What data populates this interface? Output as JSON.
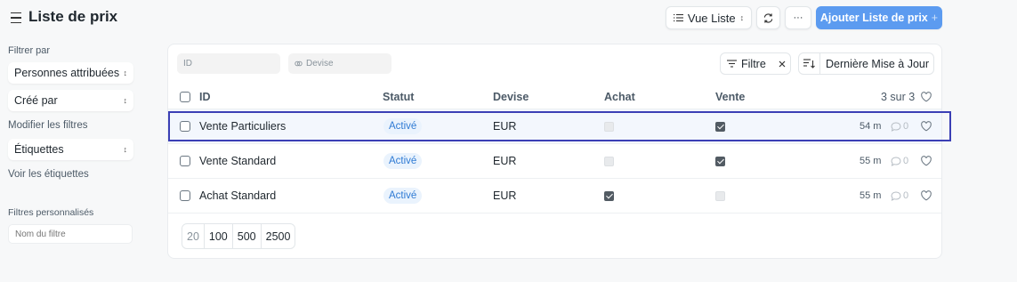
{
  "header": {
    "title": "Liste de prix",
    "view_label": "Vue Liste",
    "more_label": "···",
    "add_label": "Ajouter Liste de prix",
    "add_plus": "+"
  },
  "sidebar": {
    "filter_by": "Filtrer par",
    "assigned": "Personnes attribuées",
    "created_by": "Créé par",
    "edit_filters": "Modifier les filtres",
    "tags": "Étiquettes",
    "show_tags": "Voir les étiquettes",
    "custom_filters": "Filtres personnalisés",
    "filter_name_placeholder": "Nom du filtre"
  },
  "toolbar": {
    "id_placeholder": "ID",
    "currency_placeholder": "Devise",
    "filter_label": "Filtre",
    "sort_label": "Dernière Mise à Jour"
  },
  "table": {
    "columns": {
      "id": "ID",
      "status": "Statut",
      "currency": "Devise",
      "buying": "Achat",
      "selling": "Vente",
      "count": "3 sur 3"
    },
    "rows": [
      {
        "name": "Vente Particuliers",
        "status": "Activé",
        "currency": "EUR",
        "buying": false,
        "selling": true,
        "time": "54 m",
        "comments": "0"
      },
      {
        "name": "Vente Standard",
        "status": "Activé",
        "currency": "EUR",
        "buying": false,
        "selling": true,
        "time": "55 m",
        "comments": "0"
      },
      {
        "name": "Achat Standard",
        "status": "Activé",
        "currency": "EUR",
        "buying": true,
        "selling": false,
        "time": "55 m",
        "comments": "0"
      }
    ]
  },
  "paging": [
    "20",
    "100",
    "500",
    "2500"
  ],
  "colors": {
    "accent": "#5c9bf0",
    "badge_text": "#2f7bd4",
    "badge_bg": "#eaf3fd",
    "highlight": "#3b3fb5"
  }
}
